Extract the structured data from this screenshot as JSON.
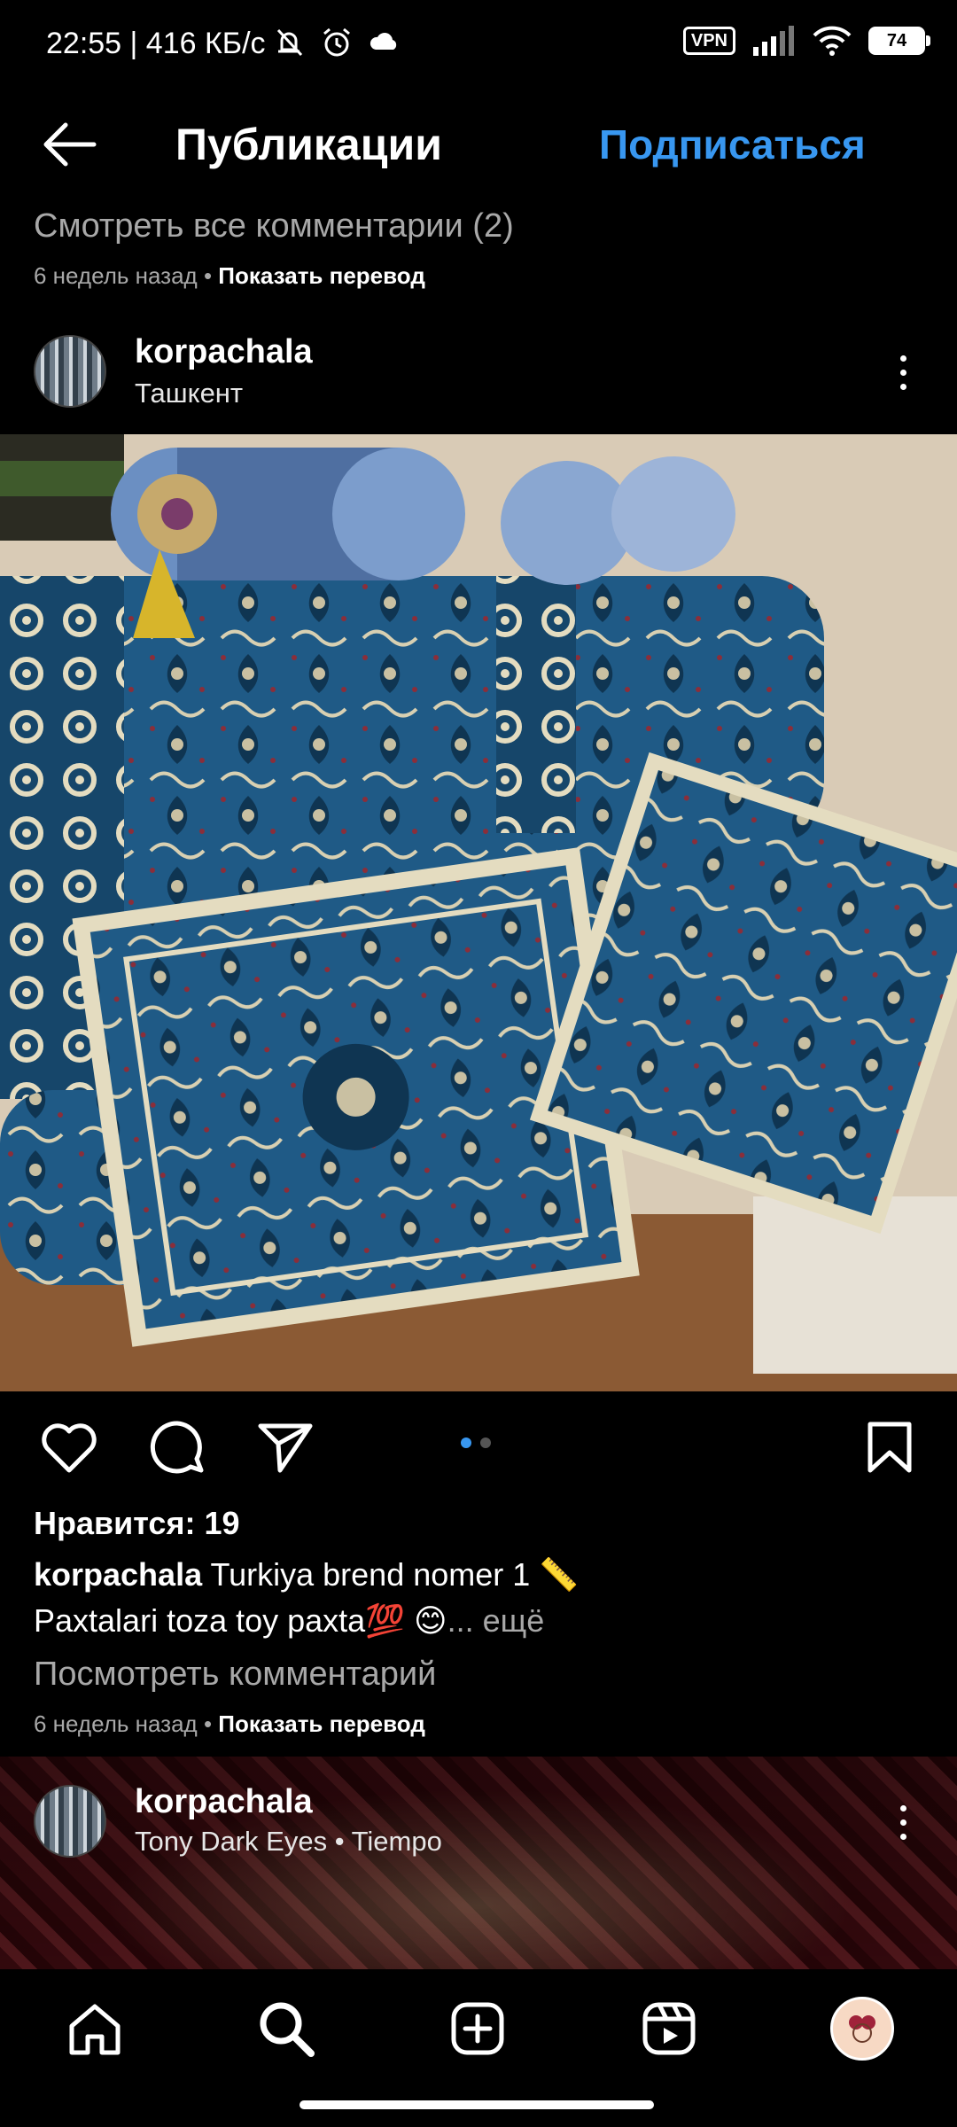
{
  "status_bar": {
    "time": "22:55 | 416 КБ/с",
    "vpn": "VPN",
    "battery": "74"
  },
  "header": {
    "title": "Публикации",
    "subscribe": "Подписаться"
  },
  "previous_post": {
    "view_all_comments": "Смотреть все комментарии (2)",
    "time_ago": "6 недель назад",
    "separator": "•",
    "translate": "Показать перевод"
  },
  "post": {
    "username": "korpachala",
    "location": "Ташкент",
    "likes": "Нравится: 19",
    "caption_user": "korpachala",
    "caption_text": "Turkiya brend nomer 1 📏",
    "caption_line2": "Paxtalari toza toy paxta💯 😊",
    "more": "... ещё",
    "view_comments": "Посмотреть комментарий",
    "time_ago": "6 недель назад",
    "separator": "•",
    "translate": "Показать перевод",
    "carousel_total": 2,
    "carousel_active": 1
  },
  "next_post": {
    "username": "korpachala",
    "audio": "Tony Dark Eyes • Tiempo"
  },
  "colors": {
    "accent": "#3897f0",
    "background": "#000000",
    "muted": "#a8a8a8"
  },
  "icons": {
    "back": "arrow-left-icon",
    "like": "heart-icon",
    "comment": "comment-icon",
    "share": "paper-plane-icon",
    "save": "bookmark-icon",
    "home": "home-icon",
    "search": "search-icon",
    "create": "plus-square-icon",
    "reels": "reels-icon"
  }
}
